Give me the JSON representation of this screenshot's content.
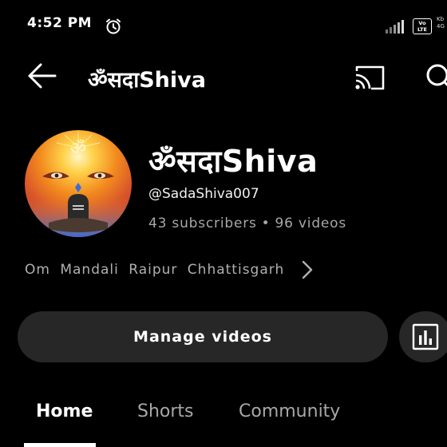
{
  "status_bar": {
    "time": "4:52 PM",
    "alarm_icon": "alarm-clock-icon",
    "signal_icon": "signal-bars-icon",
    "volte_badge": "Vo\nLTE",
    "network_mini": "Kb\n4G"
  },
  "app_bar": {
    "title": "ॐसदाShiva",
    "back_icon": "arrow-left-icon",
    "cast_icon": "cast-icon",
    "search_icon": "search-icon"
  },
  "channel": {
    "name": "ॐसदाShiva",
    "handle": "@SadaShiva007",
    "subscribers": "43 subscribers",
    "separator": "•",
    "videos": "96 videos",
    "link_text": "Om Mandali Raipur Chhattisgarh"
  },
  "actions": {
    "manage_videos_label": "Manage videos",
    "analytics_icon": "analytics-bar-chart-icon"
  },
  "tabs": [
    {
      "label": "Home",
      "selected": true
    },
    {
      "label": "Shorts",
      "selected": false
    },
    {
      "label": "Community",
      "selected": false
    }
  ],
  "colors": {
    "background": "#000000",
    "button_background": "#272727",
    "primary_text": "#ffffff",
    "secondary_text": "#a8a8a8"
  }
}
